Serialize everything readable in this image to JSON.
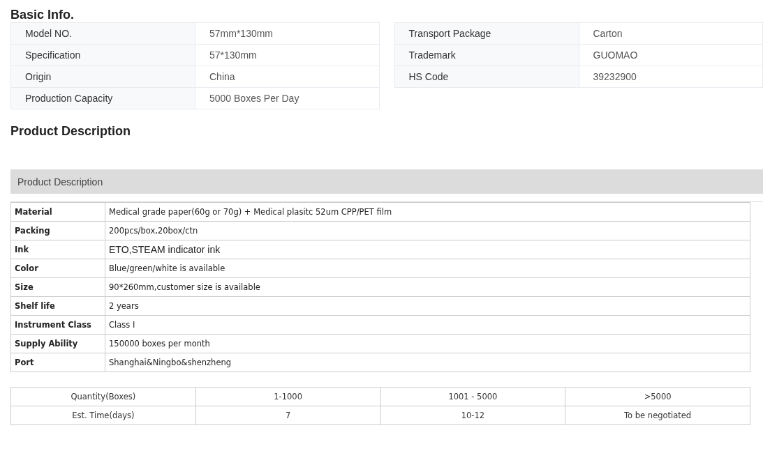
{
  "basic_info": {
    "title": "Basic Info.",
    "left_table": [
      {
        "label": "Model NO.",
        "value": "57mm*130mm"
      },
      {
        "label": "Specification",
        "value": "57*130mm"
      },
      {
        "label": "Origin",
        "value": "China"
      },
      {
        "label": "Production Capacity",
        "value": "5000 Boxes Per Day"
      }
    ],
    "right_table": [
      {
        "label": "Transport Package",
        "value": "Carton"
      },
      {
        "label": "Trademark",
        "value": "GUOMAO"
      },
      {
        "label": "HS Code",
        "value": "39232900"
      }
    ]
  },
  "product_description": {
    "title": "Product Description",
    "section_bar": "Product Description",
    "spec_rows": [
      {
        "label": "Material",
        "value": "Medical grade paper(60g or 70g) + Medical plasitc 52um CPP/PET film",
        "kind": "normal"
      },
      {
        "label": "Packing",
        "value": "200pcs/box,20box/ctn",
        "kind": "normal"
      },
      {
        "label": "Ink",
        "value": "ETO,STEAM indicator ink",
        "kind": "large"
      },
      {
        "label": "Color",
        "value": "Blue/green/white is available",
        "kind": "normal"
      },
      {
        "label": "Size",
        "value": "90*260mm,customer size is available",
        "kind": "normal"
      },
      {
        "label": "Shelf life",
        "value": "2 years",
        "kind": "normal"
      },
      {
        "label": "Instrument Class",
        "value": "Class I",
        "kind": "normal"
      },
      {
        "label": "Supply Ability",
        "value": "150000 boxes per month",
        "kind": "normal"
      },
      {
        "label": "Port",
        "value": "Shanghai&Ningbo&shenzheng",
        "kind": "normal"
      }
    ],
    "lead_time_table": [
      [
        "Quantity(Boxes)",
        "1-1000",
        "1001 - 5000",
        ">5000"
      ],
      [
        "Est. Time(days)",
        "7",
        "10-12",
        "To be negotiated"
      ]
    ]
  }
}
